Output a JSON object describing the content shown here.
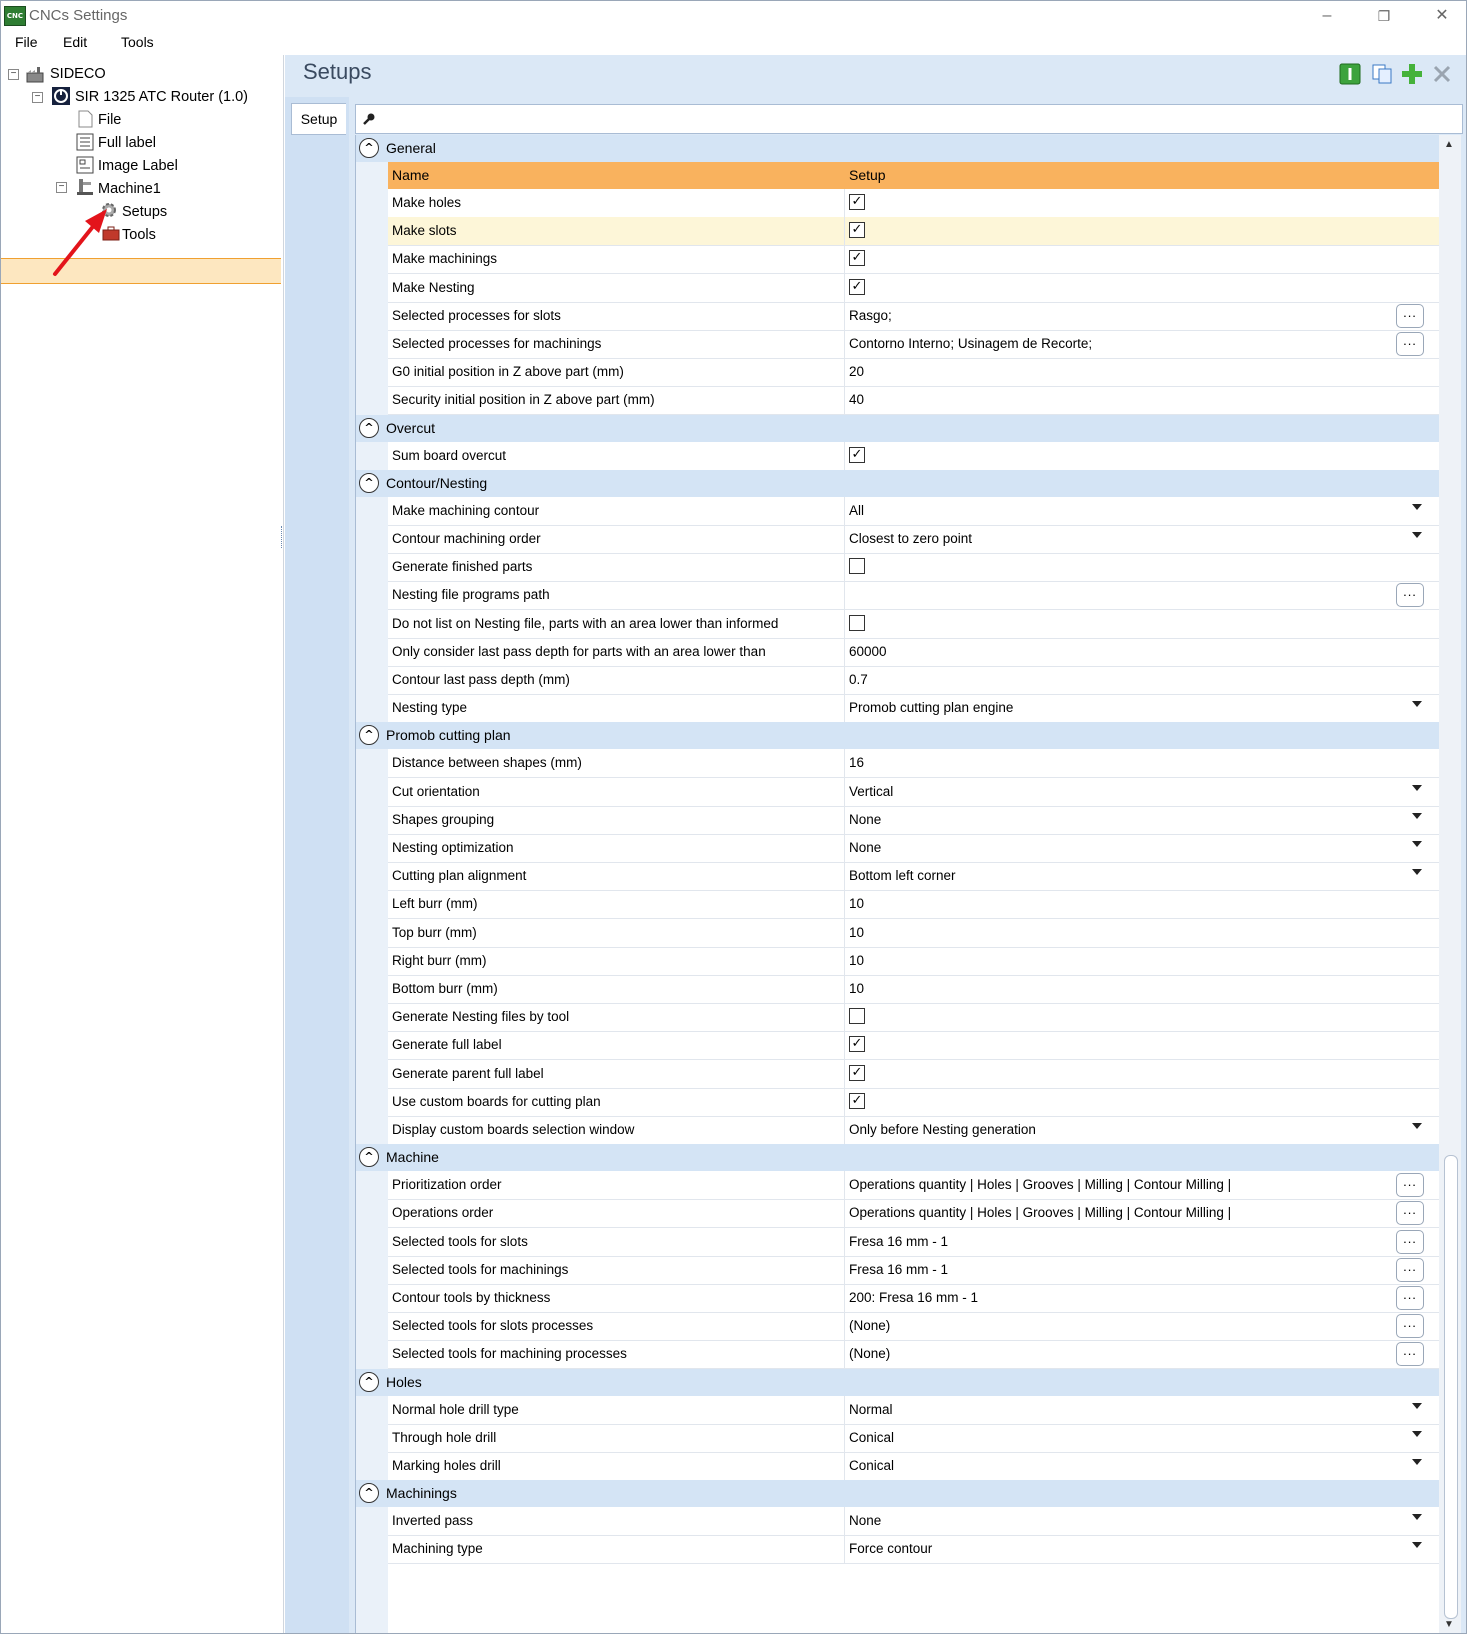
{
  "window": {
    "title": "CNCs Settings",
    "icon_text": "CNC"
  },
  "menu": [
    "File",
    "Edit",
    "Tools"
  ],
  "tree": {
    "sideco": "SIDECO",
    "router": "SIR 1325 ATC Router (1.0)",
    "file": "File",
    "full_label": "Full label",
    "image_label": "Image Label",
    "machine": "Machine1",
    "setups": "Setups",
    "tools": "Tools"
  },
  "panel": {
    "title": "Setups",
    "tab": "Setup"
  },
  "grid": {
    "header": {
      "name": "Name",
      "setup": "Setup"
    },
    "categories": [
      {
        "label": "General",
        "rows": [
          {
            "name": "Make holes",
            "type": "check",
            "checked": true
          },
          {
            "name": "Make slots",
            "type": "check",
            "checked": true,
            "highlight": true
          },
          {
            "name": "Make machinings",
            "type": "check",
            "checked": true
          },
          {
            "name": "Make Nesting",
            "type": "check",
            "checked": true
          },
          {
            "name": "Selected processes for slots",
            "type": "ellipsis",
            "value": "Rasgo;"
          },
          {
            "name": "Selected processes for machinings",
            "type": "ellipsis",
            "value": "Contorno Interno; Usinagem de Recorte;"
          },
          {
            "name": "G0 initial position in Z above part (mm)",
            "type": "text",
            "value": "20"
          },
          {
            "name": "Security initial position in Z above part (mm)",
            "type": "text",
            "value": "40"
          }
        ]
      },
      {
        "label": "Overcut",
        "rows": [
          {
            "name": "Sum board overcut",
            "type": "check",
            "checked": true
          }
        ]
      },
      {
        "label": "Contour/Nesting",
        "rows": [
          {
            "name": "Make machining contour",
            "type": "dropdown",
            "value": "All"
          },
          {
            "name": "Contour machining order",
            "type": "dropdown",
            "value": "Closest to zero point"
          },
          {
            "name": "Generate finished parts",
            "type": "check",
            "checked": false
          },
          {
            "name": "Nesting file programs path",
            "type": "ellipsis",
            "value": ""
          },
          {
            "name": "Do not list on Nesting file, parts with an area lower than informed",
            "type": "check",
            "checked": false
          },
          {
            "name": "Only consider last pass depth for parts with an area lower than",
            "type": "text",
            "value": "60000"
          },
          {
            "name": "Contour last pass depth (mm)",
            "type": "text",
            "value": "0.7"
          },
          {
            "name": "Nesting type",
            "type": "dropdown",
            "value": "Promob cutting plan engine"
          }
        ]
      },
      {
        "label": "Promob cutting plan",
        "rows": [
          {
            "name": "Distance between shapes (mm)",
            "type": "text",
            "value": "16"
          },
          {
            "name": "Cut orientation",
            "type": "dropdown",
            "value": "Vertical"
          },
          {
            "name": "Shapes grouping",
            "type": "dropdown",
            "value": "None"
          },
          {
            "name": "Nesting optimization",
            "type": "dropdown",
            "value": "None"
          },
          {
            "name": "Cutting plan alignment",
            "type": "dropdown",
            "value": "Bottom left corner"
          },
          {
            "name": "Left burr (mm)",
            "type": "text",
            "value": "10"
          },
          {
            "name": "Top burr (mm)",
            "type": "text",
            "value": "10"
          },
          {
            "name": "Right burr (mm)",
            "type": "text",
            "value": "10"
          },
          {
            "name": "Bottom burr (mm)",
            "type": "text",
            "value": "10"
          },
          {
            "name": "Generate Nesting files by tool",
            "type": "check",
            "checked": false
          },
          {
            "name": "Generate full label",
            "type": "check",
            "checked": true
          },
          {
            "name": "Generate parent full label",
            "type": "check",
            "checked": true
          },
          {
            "name": "Use custom boards for cutting plan",
            "type": "check",
            "checked": true
          },
          {
            "name": "Display custom boards selection window",
            "type": "dropdown",
            "value": "Only before Nesting generation"
          }
        ]
      },
      {
        "label": "Machine",
        "rows": [
          {
            "name": "Prioritization order",
            "type": "ellipsis",
            "value": "Operations quantity | Holes | Grooves | Milling | Contour Milling |"
          },
          {
            "name": "Operations order",
            "type": "ellipsis",
            "value": "Operations quantity | Holes | Grooves | Milling | Contour Milling |"
          },
          {
            "name": "Selected tools for slots",
            "type": "ellipsis",
            "value": "Fresa 16 mm - 1"
          },
          {
            "name": "Selected tools for machinings",
            "type": "ellipsis",
            "value": "Fresa 16 mm - 1"
          },
          {
            "name": "Contour tools by thickness",
            "type": "ellipsis",
            "value": "200: Fresa 16 mm - 1"
          },
          {
            "name": "Selected tools for slots processes",
            "type": "ellipsis",
            "value": "(None)"
          },
          {
            "name": "Selected tools for machining processes",
            "type": "ellipsis",
            "value": "(None)"
          }
        ]
      },
      {
        "label": "Holes",
        "rows": [
          {
            "name": "Normal hole drill type",
            "type": "dropdown",
            "value": "Normal"
          },
          {
            "name": "Through hole drill",
            "type": "dropdown",
            "value": "Conical"
          },
          {
            "name": "Marking holes drill",
            "type": "dropdown",
            "value": "Conical"
          }
        ]
      },
      {
        "label": "Machinings",
        "rows": [
          {
            "name": "Inverted pass",
            "type": "dropdown",
            "value": "None"
          },
          {
            "name": "Machining type",
            "type": "dropdown",
            "value": "Force contour"
          }
        ]
      }
    ]
  },
  "colors": {
    "header": "#f9b25e",
    "category": "#d4e4f5",
    "selection": "#fde7c0"
  }
}
